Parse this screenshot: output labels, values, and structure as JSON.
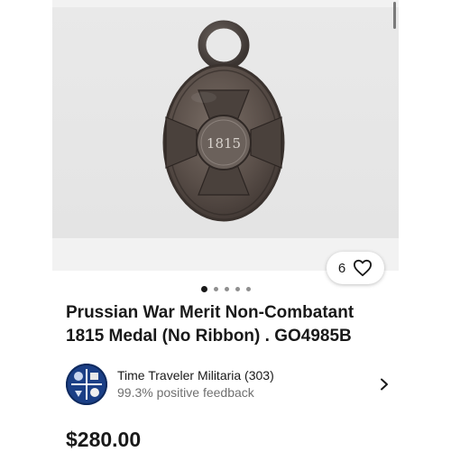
{
  "gallery": {
    "photo_alt": "Medal photo",
    "medal_year": "1815",
    "current_index": 0,
    "dot_count": 5
  },
  "watch": {
    "count": "6",
    "icon": "heart-icon"
  },
  "listing": {
    "title_line1": "Prussian War Merit Non-Combatant",
    "title_line2": "1815 Medal (No Ribbon) . GO4985B",
    "price": "$280.00"
  },
  "seller": {
    "name": "Time Traveler Militaria (303)",
    "feedback": "99.3% positive feedback",
    "avatar_icon": "seller-avatar",
    "chevron_icon": "chevron-right-icon"
  },
  "colors": {
    "text_primary": "#191919",
    "text_secondary": "#707070",
    "avatar_bg": "#1b3f86"
  }
}
